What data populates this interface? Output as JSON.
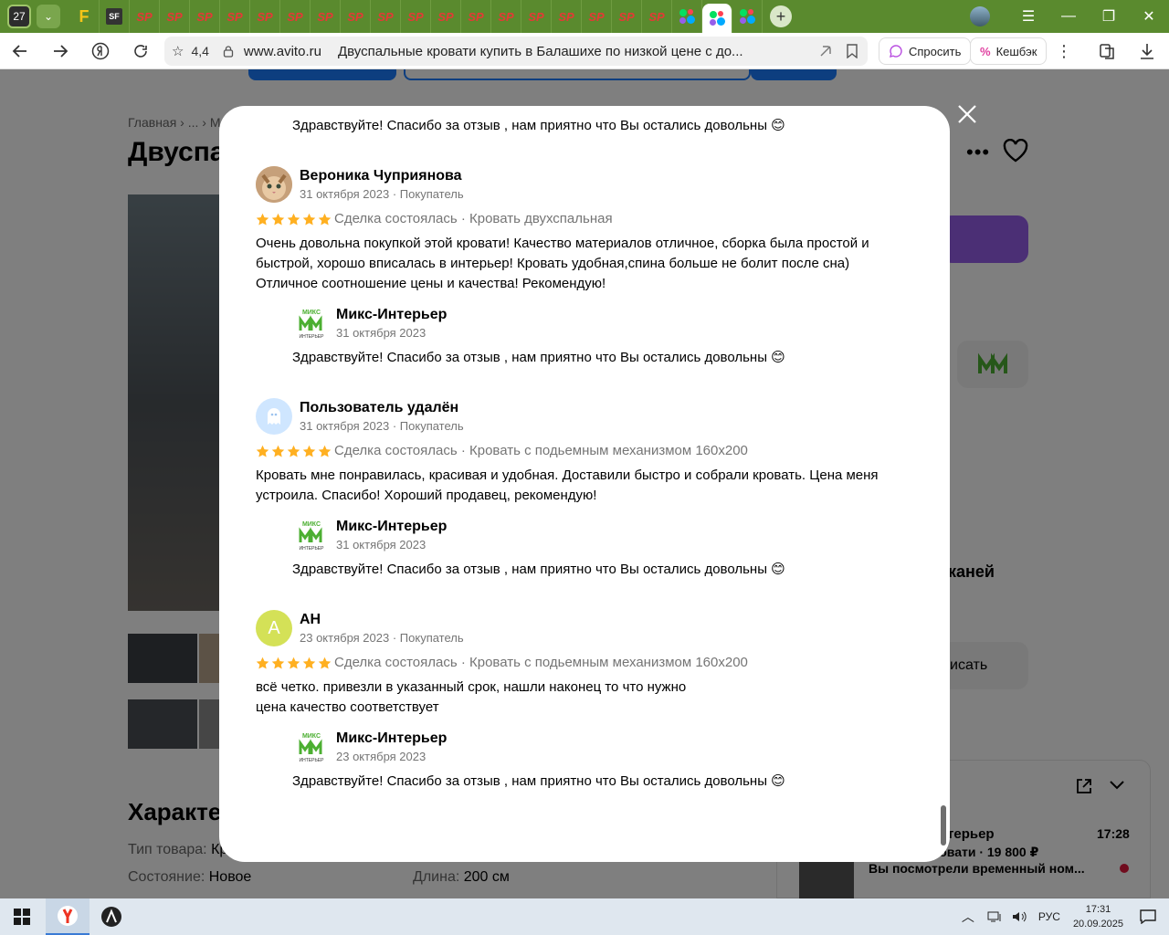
{
  "browser": {
    "tab_count": "27",
    "fav_f": "F",
    "fav_sf": "SF",
    "fav_sp": "SP",
    "new_tab": "+",
    "rating": "4,4",
    "domain": "www.avito.ru",
    "page_title": "Двуспальные кровати купить в Балашихе по низкой цене с до...",
    "ask_label": "Спросить",
    "cashback_label": "Кешбэк"
  },
  "background_page": {
    "breadcrumb": "Главная › ... › М",
    "title": "Двуспа",
    "chat_side_text": "каней",
    "write_label": "исать",
    "characteristics_heading": "Характе",
    "specs": [
      {
        "label": "Тип товара:",
        "value": "Кр"
      },
      {
        "label": "Состояние:",
        "value": "Новое"
      },
      {
        "label": "Длина:",
        "value": "200 см"
      }
    ],
    "chat_popup": {
      "seller": "терьер",
      "time": "17:28",
      "item": "е кровати · 19 800 ₽",
      "message": "Вы посмотрели временный ном..."
    }
  },
  "reviews": [
    {
      "partial_reply_only": true,
      "reply_text": "Здравствуйте! Спасибо за отзыв , нам приятно что Вы остались довольны 😊"
    },
    {
      "author": "Вероника Чуприянова",
      "date": "31 октября 2023 · Покупатель",
      "rating": 5,
      "deal": "Сделка состоялась · Кровать двухспальная",
      "text_lines": [
        "Очень довольна покупкой этой кровати! Качество материалов отличное, сборка была простой и",
        "быстрой, хорошо вписалась в интерьер! Кровать удобная,спина больше не болит после сна)",
        "Отличное соотношение цены и качества! Рекомендую!"
      ],
      "reply_author": "Микс-Интерьер",
      "reply_date": "31 октября 2023",
      "reply_text": "Здравствуйте! Спасибо за отзыв , нам приятно что Вы остались довольны 😊"
    },
    {
      "author": "Пользователь удалён",
      "date": "31 октября 2023 · Покупатель",
      "rating": 5,
      "deal": "Сделка состоялась · Кровать с подьемным механизмом 160х200",
      "text_lines": [
        "Кровать мне понравилась, красивая и удобная. Доставили быстро и собрали кровать. Цена меня",
        "устроила. Спасибо! Хороший продавец, рекомендую!"
      ],
      "reply_author": "Микс-Интерьер",
      "reply_date": "31 октября 2023",
      "reply_text": "Здравствуйте! Спасибо за отзыв , нам приятно что Вы остались довольны 😊"
    },
    {
      "author": "АН",
      "avatar_letter": "А",
      "date": "23 октября 2023 · Покупатель",
      "rating": 5,
      "deal": "Сделка состоялась · Кровать с подьемным механизмом 160х200",
      "text_lines": [
        "всё четко. привезли в указанный срок, нашли наконец то что нужно",
        "цена качество соответствует"
      ],
      "reply_author": "Микс-Интерьер",
      "reply_date": "23 октября 2023",
      "reply_text": "Здравствуйте! Спасибо за отзыв , нам приятно что Вы остались довольны 😊"
    }
  ],
  "seller_logo": {
    "line1": "МИКС",
    "line2": "ИНТЕРЬЕР"
  },
  "taskbar": {
    "lang": "РУС",
    "time": "17:31",
    "date": "20.09.2025"
  },
  "colors": {
    "tabstrip": "#5a8a2e",
    "star": "#ffb021",
    "avatar_ghost": "#cfe6ff",
    "avatar_letter_bg": "#d4e157",
    "seller_logo_green": "#4caf32"
  }
}
